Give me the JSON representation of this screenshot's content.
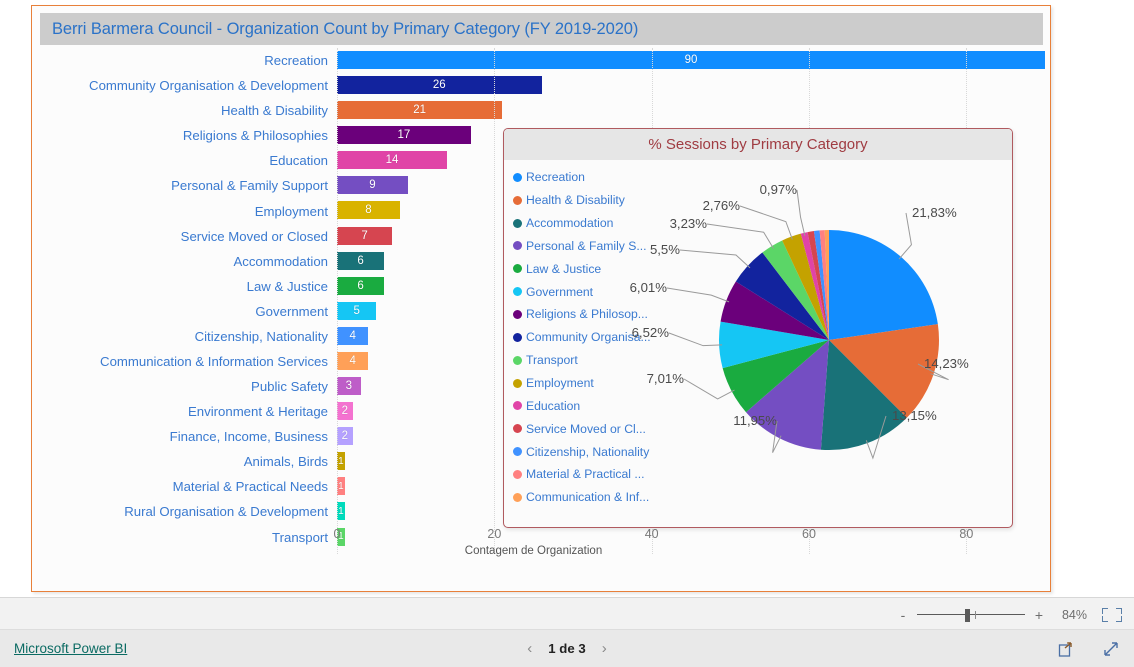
{
  "visual": {
    "title": "Berri Barmera Council - Organization Count by Primary Category (FY 2019-2020)"
  },
  "chart_data": [
    {
      "type": "bar",
      "orientation": "horizontal",
      "title": "Berri Barmera Council - Organization Count by Primary Category (FY 2019-2020)",
      "xlabel": "Contagem de Organization",
      "ylabel": "",
      "xlim": [
        0,
        90
      ],
      "grid": true,
      "ticks": [
        "0",
        "20",
        "40",
        "60",
        "80"
      ],
      "tick_values": [
        0,
        20,
        40,
        60,
        80
      ],
      "categories": [
        "Recreation",
        "Community Organisation & Development",
        "Health & Disability",
        "Religions & Philosophies",
        "Education",
        "Personal & Family Support",
        "Employment",
        "Service Moved or Closed",
        "Accommodation",
        "Law & Justice",
        "Government",
        "Citizenship, Nationality",
        "Communication & Information Services",
        "Public Safety",
        "Environment & Heritage",
        "Finance, Income, Business",
        "Animals, Birds",
        "Material & Practical Needs",
        "Rural Organisation & Development",
        "Transport"
      ],
      "values": [
        90,
        26,
        21,
        17,
        14,
        9,
        8,
        7,
        6,
        6,
        5,
        4,
        4,
        3,
        2,
        2,
        1,
        1,
        1,
        1
      ],
      "colors": [
        "#118DFF",
        "#12239E",
        "#E66C37",
        "#6B007B",
        "#E044A7",
        "#744EC2",
        "#D9B300",
        "#D64550",
        "#197278",
        "#1AAB40",
        "#15C6F4",
        "#4092FF",
        "#FFA058",
        "#BE5DC8",
        "#F472D0",
        "#B5A1FF",
        "#C4A200",
        "#FF8080",
        "#00DBBC",
        "#5BD667"
      ]
    },
    {
      "type": "pie",
      "title": "% Sessions by Primary Category",
      "legend_position": "left",
      "labels": [
        "Recreation",
        "Health & Disability",
        "Accommodation",
        "Personal & Family S...",
        "Law & Justice",
        "Government",
        "Religions & Philosop...",
        "Community Organisa...",
        "Transport",
        "Employment",
        "Education",
        "Service Moved or Cl...",
        "Citizenship, Nationality",
        "Material & Practical ...",
        "Communication & Inf..."
      ],
      "values": [
        21.83,
        14.23,
        13.15,
        11.95,
        7.01,
        6.52,
        6.01,
        5.5,
        3.23,
        2.76,
        0.97,
        0.9,
        0.8,
        0.7,
        0.6
      ],
      "value_labels": [
        "21,83%",
        "14,23%",
        "13,15%",
        "11,95%",
        "7,01%",
        "6,52%",
        "6,01%",
        "5,5%",
        "3,23%",
        "2,76%",
        "0,97%"
      ],
      "colors": [
        "#118DFF",
        "#E66C37",
        "#197278",
        "#744EC2",
        "#1AAB40",
        "#15C6F4",
        "#6B007B",
        "#12239E",
        "#5BD667",
        "#C4A200",
        "#E044A7",
        "#D64550",
        "#4092FF",
        "#FF8080",
        "#FFA058"
      ]
    }
  ],
  "pie": {
    "title": "% Sessions by Primary Category",
    "legend": [
      {
        "label": "Recreation",
        "color": "#118DFF"
      },
      {
        "label": "Health & Disability",
        "color": "#E66C37"
      },
      {
        "label": "Accommodation",
        "color": "#197278"
      },
      {
        "label": "Personal & Family S...",
        "color": "#744EC2"
      },
      {
        "label": "Law & Justice",
        "color": "#1AAB40"
      },
      {
        "label": "Government",
        "color": "#15C6F4"
      },
      {
        "label": "Religions & Philosop...",
        "color": "#6B007B"
      },
      {
        "label": "Community Organisa...",
        "color": "#12239E"
      },
      {
        "label": "Transport",
        "color": "#5BD667"
      },
      {
        "label": "Employment",
        "color": "#C4A200"
      },
      {
        "label": "Education",
        "color": "#E044A7"
      },
      {
        "label": "Service Moved or Cl...",
        "color": "#D64550"
      },
      {
        "label": "Citizenship, Nationality",
        "color": "#4092FF"
      },
      {
        "label": "Material & Practical ...",
        "color": "#FF8080"
      },
      {
        "label": "Communication & Inf...",
        "color": "#FFA058"
      }
    ],
    "callouts": [
      {
        "text": "21,83%"
      },
      {
        "text": "14,23%"
      },
      {
        "text": "13,15%"
      },
      {
        "text": "11,95%"
      },
      {
        "text": "7,01%"
      },
      {
        "text": "6,52%"
      },
      {
        "text": "6,01%"
      },
      {
        "text": "5,5%"
      },
      {
        "text": "3,23%"
      },
      {
        "text": "2,76%"
      },
      {
        "text": "0,97%"
      }
    ]
  },
  "statusbar": {
    "zoom_minus": "-",
    "zoom_plus": "+",
    "zoom_level": "84%"
  },
  "footer": {
    "brand": "Microsoft Power BI",
    "prev": "‹",
    "page": "1 de 3",
    "next": "›"
  }
}
